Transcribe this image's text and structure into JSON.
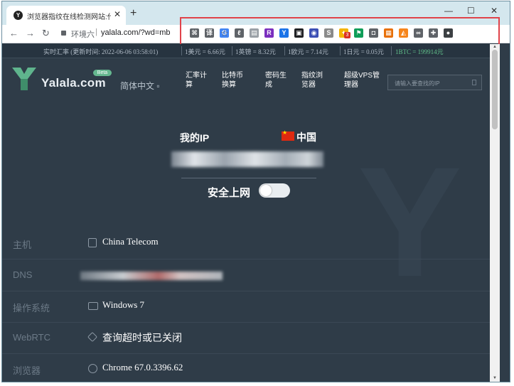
{
  "browser": {
    "tab_title": "浏览器指纹在线检测网站:代理IP",
    "tab_favicon": "Y",
    "close_glyph": "✕",
    "new_tab_glyph": "+",
    "win_minimize": "—",
    "win_maximize": "☐",
    "win_close": "✕",
    "back_glyph": "←",
    "forward_glyph": "→",
    "reload_glyph": "↻",
    "url_zone": "环境六",
    "url": "yalala.com/?wd=mb",
    "star_glyph": "☆",
    "menu_glyph": "⋮",
    "extensions": [
      {
        "name": "qr-ext",
        "label": "⌘",
        "color": "#5f6368"
      },
      {
        "name": "translate-ext",
        "label": "译",
        "color": "#5f6368"
      },
      {
        "name": "google-translate-ext",
        "label": "G",
        "color": "#4285f4"
      },
      {
        "name": "leaf-ext",
        "label": "ℓ",
        "color": "#5f6368"
      },
      {
        "name": "gray-ext",
        "label": "▤",
        "color": "#9aa0a6"
      },
      {
        "name": "r-ext",
        "label": "R",
        "color": "#7b2fbe"
      },
      {
        "name": "y-ext",
        "label": "Y",
        "color": "#1a73e8"
      },
      {
        "name": "tabs-ext",
        "label": "▣",
        "color": "#202124"
      },
      {
        "name": "circle-ext",
        "label": "◉",
        "color": "#3c4fb5"
      },
      {
        "name": "s-ext",
        "label": "S",
        "color": "#8a8a8a"
      },
      {
        "name": "bulb-ext",
        "label": "✦",
        "color": "#f4b400",
        "badge": "3"
      },
      {
        "name": "flag-ext",
        "label": "⚑",
        "color": "#0f9d58"
      },
      {
        "name": "box-ext",
        "label": "◘",
        "color": "#5f6368"
      },
      {
        "name": "colors-ext",
        "label": "▦",
        "color": "#e8710a"
      },
      {
        "name": "fox-ext",
        "label": "◭",
        "color": "#f6851b"
      },
      {
        "name": "link-ext",
        "label": "∞",
        "color": "#5f6368"
      },
      {
        "name": "puzzle-ext",
        "label": "✚",
        "color": "#5f6368"
      },
      {
        "name": "profile-ext",
        "label": "●",
        "color": "#3c4043"
      }
    ]
  },
  "ratebar": {
    "updated": "实时汇率 (更新时间: 2022-06-06 03:58:01)",
    "usd": "1美元 = 6.66元",
    "gbp": "1英镑 = 8.32元",
    "eur": "1欧元 = 7.14元",
    "jpy": "1日元 = 0.05元",
    "btc": "1BTC = 199914元"
  },
  "site": {
    "logo_text": "Yalala.com",
    "beta": "Beta",
    "lang": "简体中文 ▫",
    "nav_fx": "汇率计\n算",
    "nav_btc": "比特币\n换算",
    "nav_pwd": "密码生\n成",
    "nav_fp": "指纹浏\n览器",
    "nav_vps": "超级VPS管\n理器",
    "search_placeholder": "请输入要查找的IP"
  },
  "hero": {
    "my_ip": "我的IP",
    "country": "中国",
    "safe_label": "安全上网"
  },
  "details": {
    "host_label": "主机",
    "host_value": "China Telecom",
    "dns_label": "DNS",
    "os_label": "操作系统",
    "os_value": "Windows 7",
    "webrtc_label": "WebRTC",
    "webrtc_value": "查询超时或已关闭",
    "browser_label": "浏览器",
    "browser_value": "Chrome 67.0.3396.62"
  },
  "colors": {
    "page_bg": "#2f3c48",
    "highlight_box": "#e0434a",
    "btc_green": "#61c08a"
  }
}
